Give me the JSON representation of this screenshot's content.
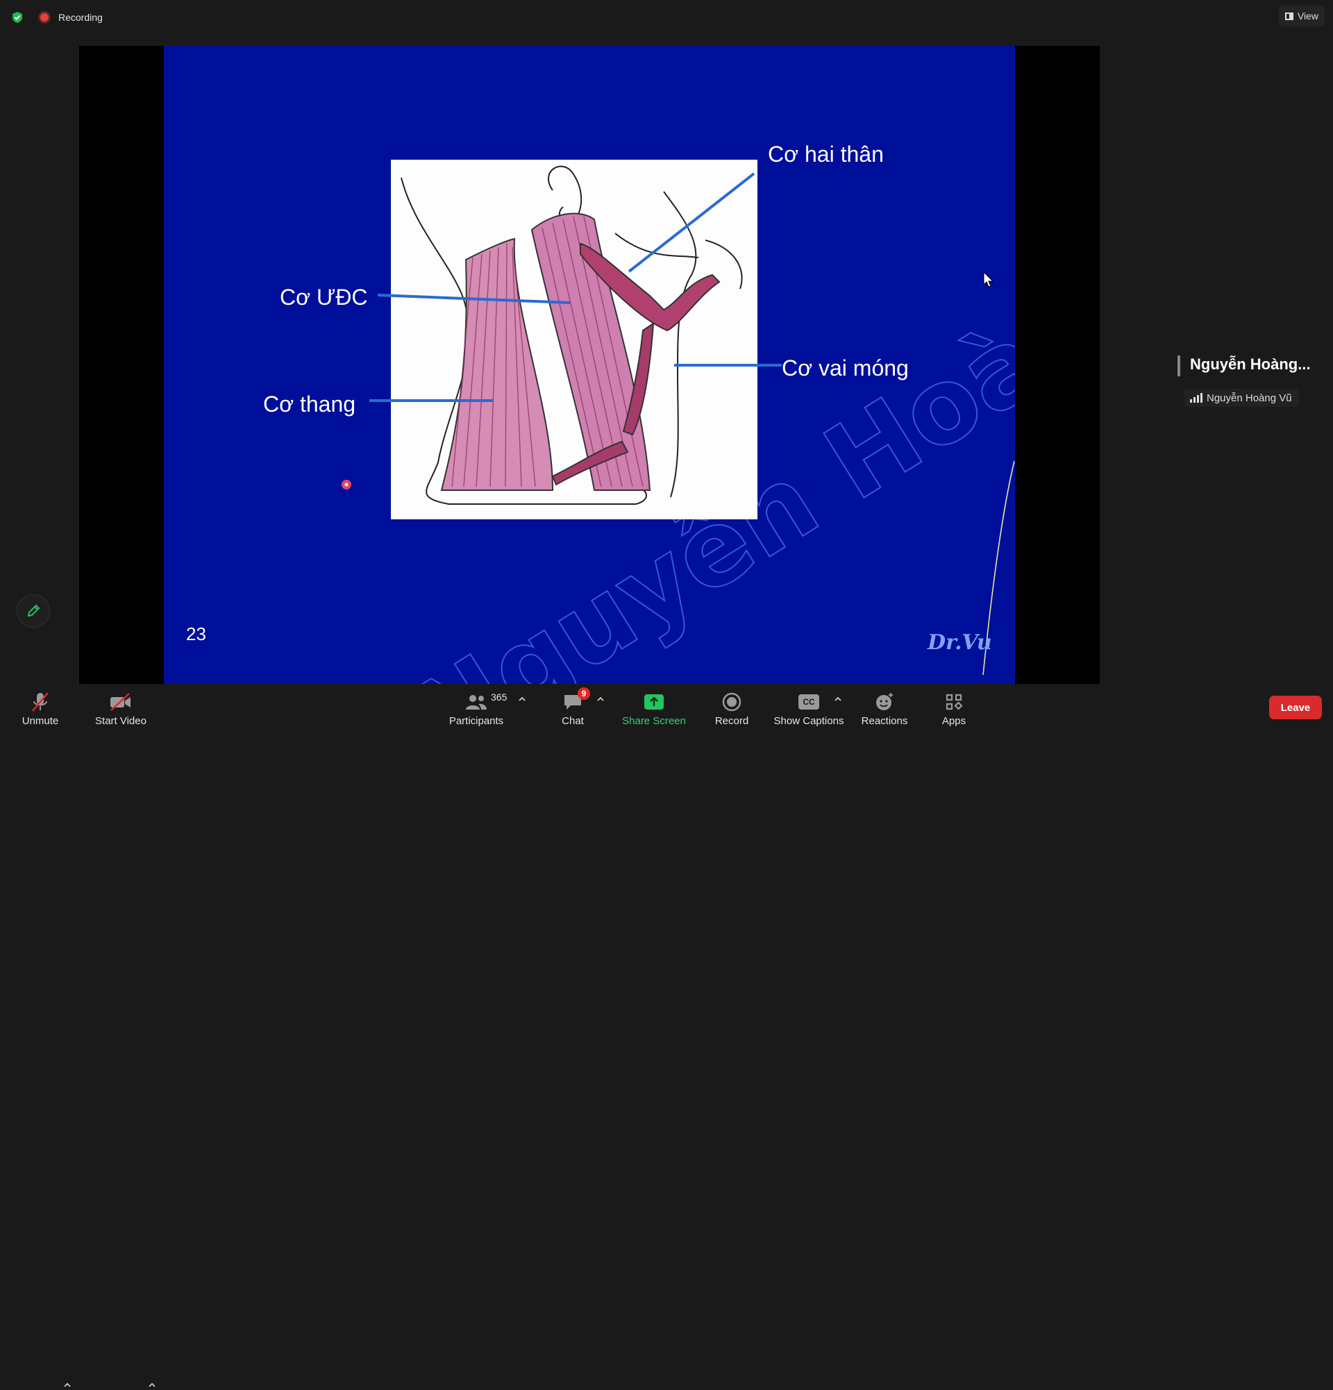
{
  "topbar": {
    "recording_label": "Recording",
    "view_label": "View"
  },
  "slide": {
    "labels": {
      "co_hai_than": "Cơ hai thân",
      "co_udc": "Cơ ƯĐC",
      "co_vai_mong": "Cơ vai móng",
      "co_thang": "Cơ thang"
    },
    "page_number": "23",
    "signature": "Dr.Vu",
    "watermark": "Nguyễn Hoàng Vũ",
    "colors": {
      "background": "#000f9a",
      "leader_lines": "#2a6bd0",
      "muscle": "#c0508a"
    }
  },
  "participant": {
    "display_name": "Nguyễn Hoàng...",
    "name_tag": "Nguyễn Hoàng Vũ"
  },
  "toolbar": {
    "unmute": "Unmute",
    "start_video": "Start Video",
    "participants": "Participants",
    "participants_count": "365",
    "chat": "Chat",
    "chat_badge": "9",
    "share_screen": "Share Screen",
    "record": "Record",
    "show_captions": "Show Captions",
    "captions_icon_text": "CC",
    "reactions": "Reactions",
    "apps": "Apps",
    "leave": "Leave"
  }
}
